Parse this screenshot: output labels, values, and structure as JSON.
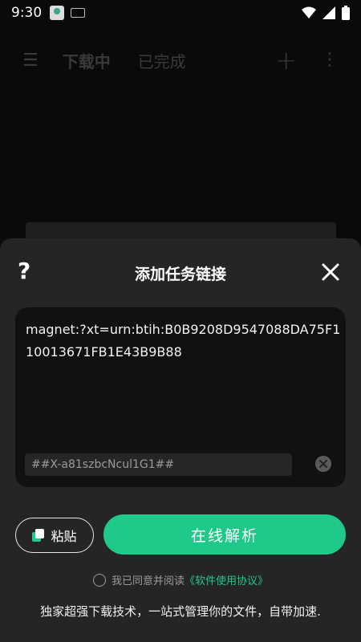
{
  "status_bar": {
    "time": "9:30"
  },
  "app_bar": {
    "tabs": [
      "下载中",
      "已完成"
    ]
  },
  "dialog": {
    "title": "添加任务链接",
    "link_value": "magnet:?xt=urn:btih:B0B9208D9547088DA75F110013671FB1E43B9B88",
    "password_value": "##X-a81szbcNcul1G1##",
    "paste_label": "粘贴",
    "parse_label": "在线解析",
    "agree_text": "我已同意并阅读",
    "agreement_link": "《软件使用协议》",
    "slogan": "独家超强下载技术，一站式管理你的文件，自带加速."
  },
  "colors": {
    "accent": "#1ec98a",
    "sheet": "#252525",
    "input_bg": "#111111"
  }
}
